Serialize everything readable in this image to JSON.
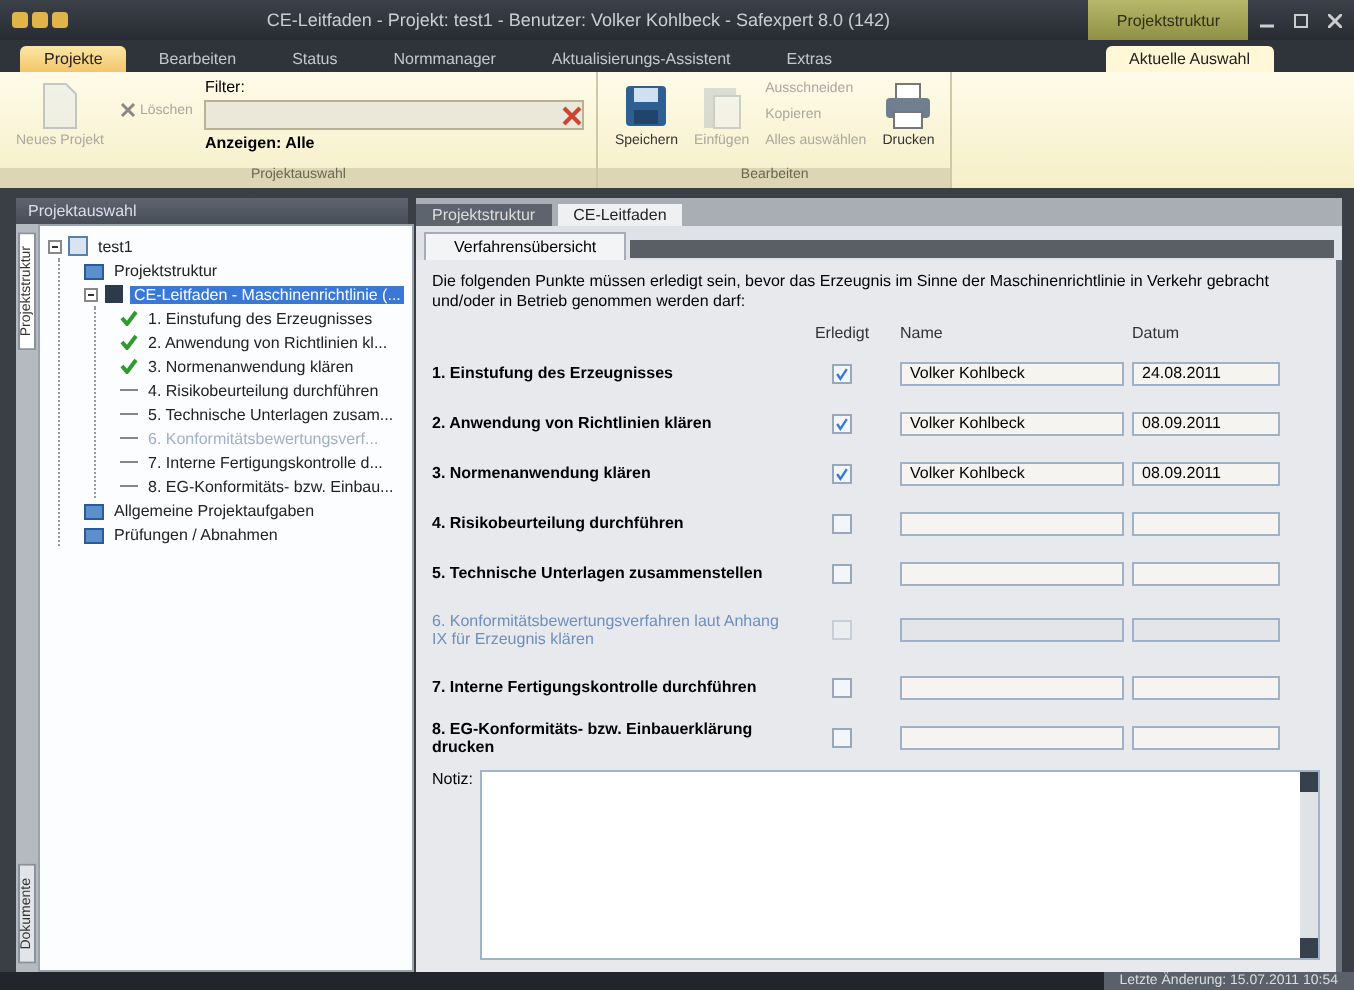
{
  "window": {
    "title": "CE-Leitfaden - Projekt: test1 - Benutzer: Volker Kohlbeck - Safexpert 8.0 (142)",
    "context_label": "Projektstruktur"
  },
  "ribbon_tabs": [
    {
      "label": "Projekte",
      "selected": true
    },
    {
      "label": "Bearbeiten",
      "selected": false
    },
    {
      "label": "Status",
      "selected": false
    },
    {
      "label": "Normmanager",
      "selected": false
    },
    {
      "label": "Aktualisierungs-Assistent",
      "selected": false
    },
    {
      "label": "Extras",
      "selected": false
    }
  ],
  "context_tab": {
    "label": "Aktuelle Auswahl",
    "selected": false
  },
  "ribbon_groups": [
    {
      "title": "Projektauswahl",
      "items": [
        {
          "kind": "large",
          "label": "Neues Projekt",
          "disabled": true
        },
        {
          "kind": "small",
          "label": "Löschen",
          "disabled": true
        },
        {
          "kind": "filter",
          "label": "Filter:",
          "show": "Anzeigen: Alle"
        }
      ]
    },
    {
      "title": "Bearbeiten",
      "items": [
        {
          "kind": "large",
          "label": "Speichern",
          "disabled": false
        },
        {
          "kind": "large",
          "label": "Einfügen",
          "disabled": true
        },
        {
          "kind": "stack",
          "entries": [
            {
              "label": "Ausschneiden",
              "disabled": true
            },
            {
              "label": "Kopieren",
              "disabled": true
            },
            {
              "label": "Alles auswählen",
              "disabled": true
            }
          ]
        },
        {
          "kind": "large",
          "label": "Drucken",
          "disabled": false
        }
      ]
    }
  ],
  "sidebar": {
    "title": "Projektauswahl",
    "side_tabs": [
      {
        "label": "Projektstruktur",
        "selected": true
      },
      {
        "label": "Dokumente",
        "selected": false
      }
    ],
    "tree": [
      {
        "label": "test1",
        "kind": "project",
        "selected": false,
        "expanded": true,
        "children": [
          {
            "label": "Projektstruktur",
            "kind": "folder",
            "selected": false
          },
          {
            "label": "CE-Leitfaden - Maschinenrichtlinie (...",
            "kind": "guide",
            "selected": true,
            "expanded": true,
            "children": [
              {
                "label": "1. Einstufung des Erzeugnisses",
                "kind": "step",
                "selected": false,
                "done": true,
                "disabled": false
              },
              {
                "label": "2. Anwendung von Richtlinien kl...",
                "kind": "step",
                "selected": false,
                "done": true,
                "disabled": false
              },
              {
                "label": "3. Normenanwendung klären",
                "kind": "step",
                "selected": false,
                "done": true,
                "disabled": false
              },
              {
                "label": "4. Risikobeurteilung durchführen",
                "kind": "step",
                "selected": false,
                "done": false,
                "disabled": false
              },
              {
                "label": "5. Technische Unterlagen zusam...",
                "kind": "step",
                "selected": false,
                "done": false,
                "disabled": false
              },
              {
                "label": "6. Konformitätsbewertungsverf...",
                "kind": "step",
                "selected": false,
                "done": false,
                "disabled": true
              },
              {
                "label": "7. Interne Fertigungskontrolle d...",
                "kind": "step",
                "selected": false,
                "done": false,
                "disabled": false
              },
              {
                "label": "8. EG-Konformitäts- bzw. Einbau...",
                "kind": "step",
                "selected": false,
                "done": false,
                "disabled": false
              }
            ]
          },
          {
            "label": "Allgemeine Projektaufgaben",
            "kind": "folder",
            "selected": false
          },
          {
            "label": "Prüfungen / Abnahmen",
            "kind": "folder",
            "selected": false
          }
        ]
      }
    ]
  },
  "doc_tabs": [
    {
      "label": "Projektstruktur",
      "selected": false
    },
    {
      "label": "CE-Leitfaden",
      "selected": true
    }
  ],
  "inner_tabs": [
    {
      "label": "Verfahrensübersicht",
      "selected": true
    }
  ],
  "intro": "Die folgenden Punkte müssen erledigt sein, bevor das Erzeugnis im Sinne der Maschinenrichtlinie in Verkehr gebracht und/oder in Betrieb genommen werden darf:",
  "columns": [
    "Erledigt",
    "Name",
    "Datum"
  ],
  "rows": [
    {
      "step": "1. Einstufung des Erzeugnisses",
      "checked": true,
      "disabled": false,
      "name": "Volker Kohlbeck",
      "date": "24.08.2011"
    },
    {
      "step": "2. Anwendung von Richtlinien klären",
      "checked": true,
      "disabled": false,
      "name": "Volker Kohlbeck",
      "date": "08.09.2011"
    },
    {
      "step": "3. Normenanwendung klären",
      "checked": true,
      "disabled": false,
      "name": "Volker Kohlbeck",
      "date": "08.09.2011"
    },
    {
      "step": "4. Risikobeurteilung durchführen",
      "checked": false,
      "disabled": false
    },
    {
      "step": "5. Technische Unterlagen zusammenstellen",
      "checked": false,
      "disabled": false
    },
    {
      "step": "6. Konformitätsbewertungsverfahren laut Anhang IX für Erzeugnis klären",
      "checked": false,
      "disabled": true
    },
    {
      "step": "7. Interne Fertigungskontrolle durchführen",
      "checked": false,
      "disabled": false
    },
    {
      "step": "8. EG-Konformitäts- bzw. Einbauerklärung drucken",
      "checked": false,
      "disabled": false
    }
  ],
  "note_label": "Notiz:",
  "status_bar": "Letzte Änderung: 15.07.2011 10:54"
}
